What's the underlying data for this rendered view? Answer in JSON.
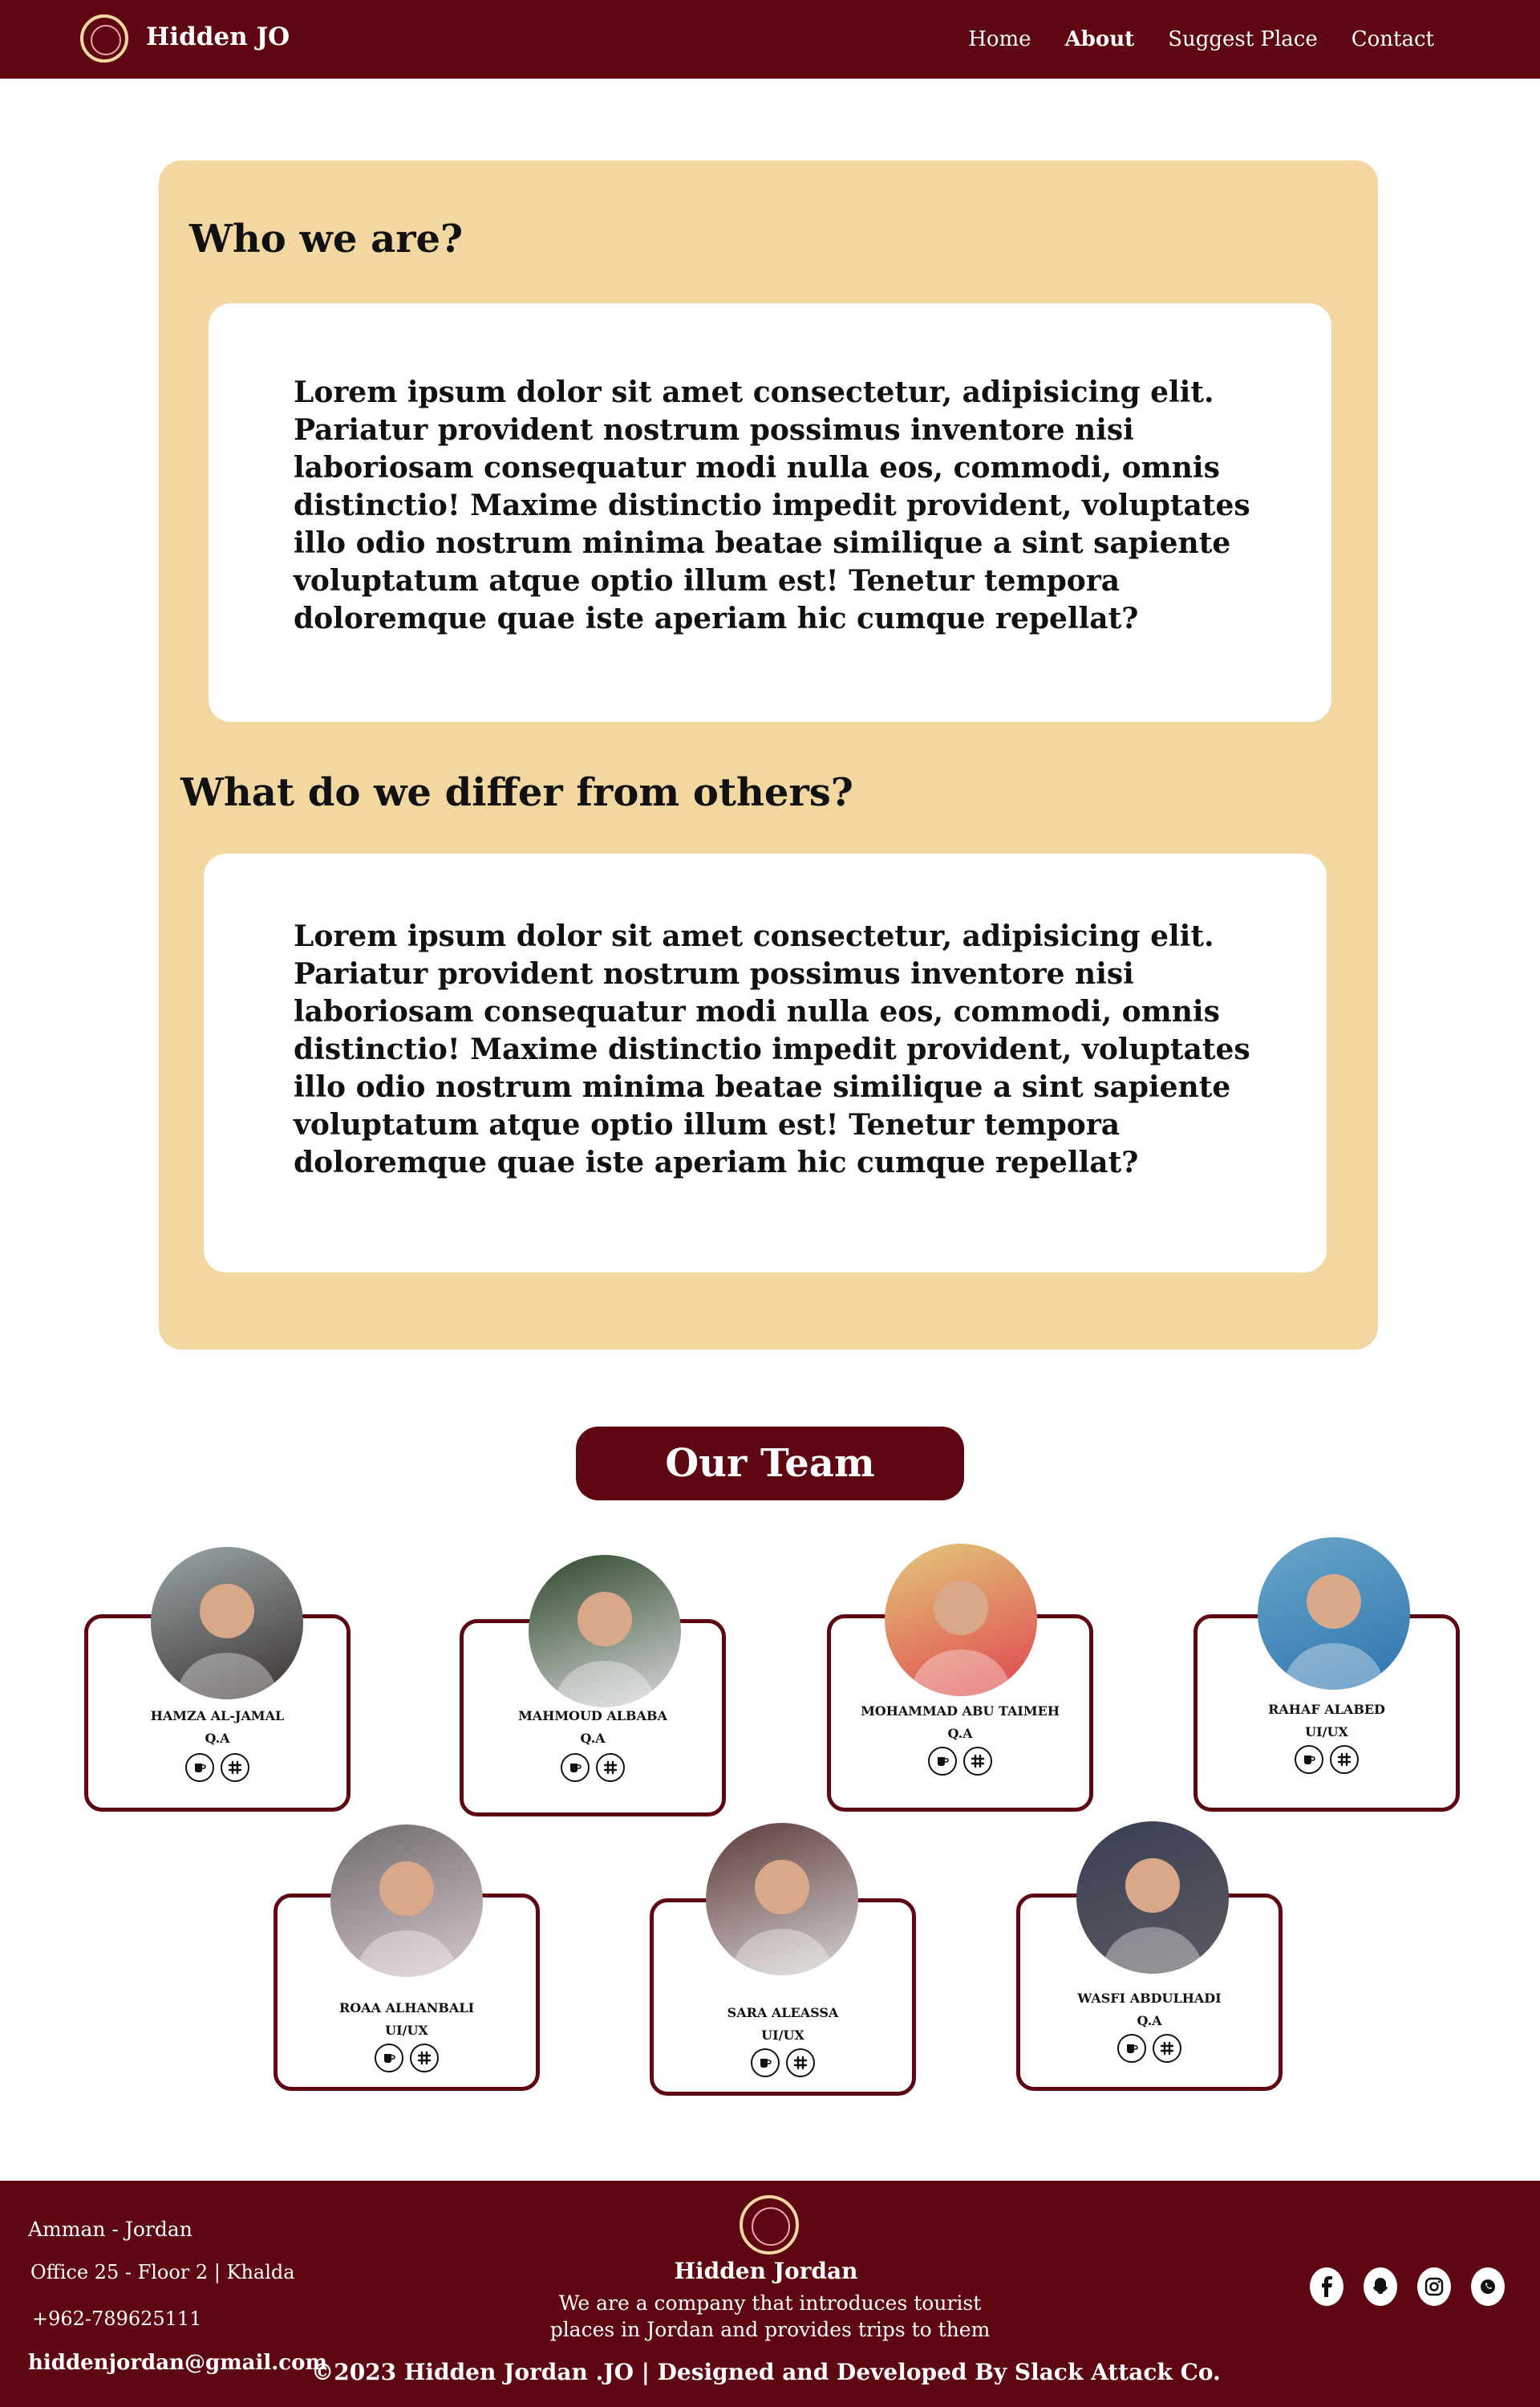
{
  "nav": {
    "brand": "Hidden JO",
    "links": [
      {
        "label": "Home",
        "active": false
      },
      {
        "label": "About",
        "active": true
      },
      {
        "label": "Suggest Place",
        "active": false
      },
      {
        "label": "Contact",
        "active": false
      }
    ]
  },
  "about": {
    "sections": [
      {
        "heading": "Who we are?",
        "body": "Lorem ipsum dolor sit amet consectetur, adipisicing elit. Pariatur provident nostrum possimus inventore nisi laboriosam consequatur modi nulla eos, commodi, omnis distinctio! Maxime distinctio impedit provident, voluptates illo odio nostrum minima beatae similique a sint sapiente voluptatum atque optio illum est! Tenetur tempora doloremque quae iste aperiam hic cumque repellat?"
      },
      {
        "heading": "What do we differ from others?",
        "body": "Lorem ipsum dolor sit amet consectetur, adipisicing elit. Pariatur provident nostrum possimus inventore nisi laboriosam consequatur modi nulla eos, commodi, omnis distinctio! Maxime distinctio impedit provident, voluptates illo odio nostrum minima beatae similique a sint sapiente voluptatum atque optio illum est! Tenetur tempora doloremque quae iste aperiam hic cumque repellat?"
      }
    ]
  },
  "team": {
    "title": "Our Team",
    "members": [
      {
        "name": "HAMZA AL-JAMAL",
        "role": "Q.A",
        "icons": [
          "mug-icon",
          "slack-icon"
        ]
      },
      {
        "name": "MAHMOUD ALBABA",
        "role": "Q.A",
        "icons": [
          "mug-icon",
          "slack-icon"
        ]
      },
      {
        "name": "MOHAMMAD ABU TAIMEH",
        "role": "Q.A",
        "icons": [
          "mug-icon",
          "slack-icon"
        ]
      },
      {
        "name": "RAHAF ALABED",
        "role": "UI/UX",
        "icons": [
          "mug-icon",
          "slack-icon"
        ]
      },
      {
        "name": "ROAA ALHANBALI",
        "role": "UI/UX",
        "icons": [
          "mug-icon",
          "slack-icon"
        ]
      },
      {
        "name": "SARA ALEASSA",
        "role": "UI/UX",
        "icons": [
          "mug-icon",
          "slack-icon"
        ]
      },
      {
        "name": "WASFI ABDULHADI",
        "role": "Q.A",
        "icons": [
          "mug-icon",
          "slack-icon"
        ]
      }
    ]
  },
  "footer": {
    "address": "Amman - Jordan",
    "office": "Office 25 - Floor 2 | Khalda",
    "phone": "+962-789625111",
    "email": "hiddenjordan@gmail.com",
    "company": "Hidden Jordan",
    "description": "We are a company that introduces tourist places in Jordan and provides trips to them",
    "copyright": "©2023 Hidden Jordan .JO | Designed and Developed By Slack Attack Co.",
    "socials": [
      "facebook-icon",
      "snapchat-icon",
      "instagram-icon",
      "whatsapp-icon"
    ]
  },
  "colors": {
    "brand": "#5e0712",
    "sand": "#f2d8a0",
    "white": "#ffffff"
  }
}
